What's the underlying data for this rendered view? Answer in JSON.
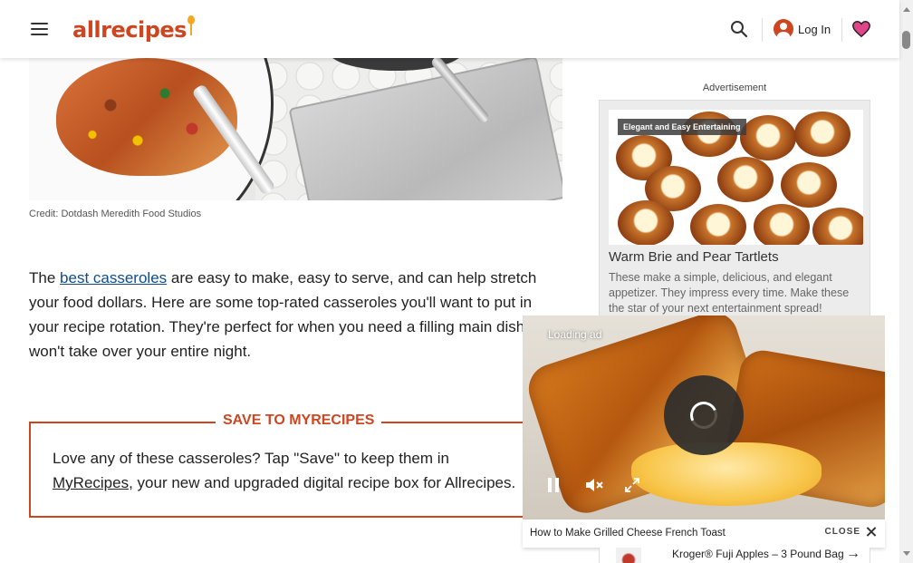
{
  "header": {
    "logo_text": "allrecipes",
    "login_label": "Log In"
  },
  "hero": {
    "credit": "Credit: Dotdash Meredith Food Studios"
  },
  "intro": {
    "before_link": "The ",
    "link_text": "best casseroles",
    "after_link": " are easy to make, easy to serve, and can help stretch your food dollars. Here are some top-rated casseroles you'll want to put in your recipe rotation. They're perfect for when you need a filling main dish that won't take over your entire night."
  },
  "save_box": {
    "title": "SAVE TO MYRECIPES",
    "text_before": "Love any of these casseroles? Tap \"Save\" to keep them in ",
    "link_text": "MyRecipes",
    "text_after": ", your new and upgraded digital recipe box for Allrecipes."
  },
  "sidebar_ad": {
    "label": "Advertisement",
    "tag": "Elegant and Easy Entertaining",
    "title": "Warm Brie and Pear Tartlets",
    "description": "These make a simple, delicious, and elegant appetizer. They impress every time. Make these the star of your next entertainment spread!"
  },
  "video": {
    "loading_text": "Loading ad",
    "caption": "How to Make Grilled Cheese French Toast",
    "close_label": "CLOSE"
  },
  "product": {
    "name": "Kroger® Fuji Apples – 3 Pound Bag"
  },
  "colors": {
    "brand": "#ce4620",
    "link": "#0f4c8a",
    "heart": "#e0458a"
  }
}
